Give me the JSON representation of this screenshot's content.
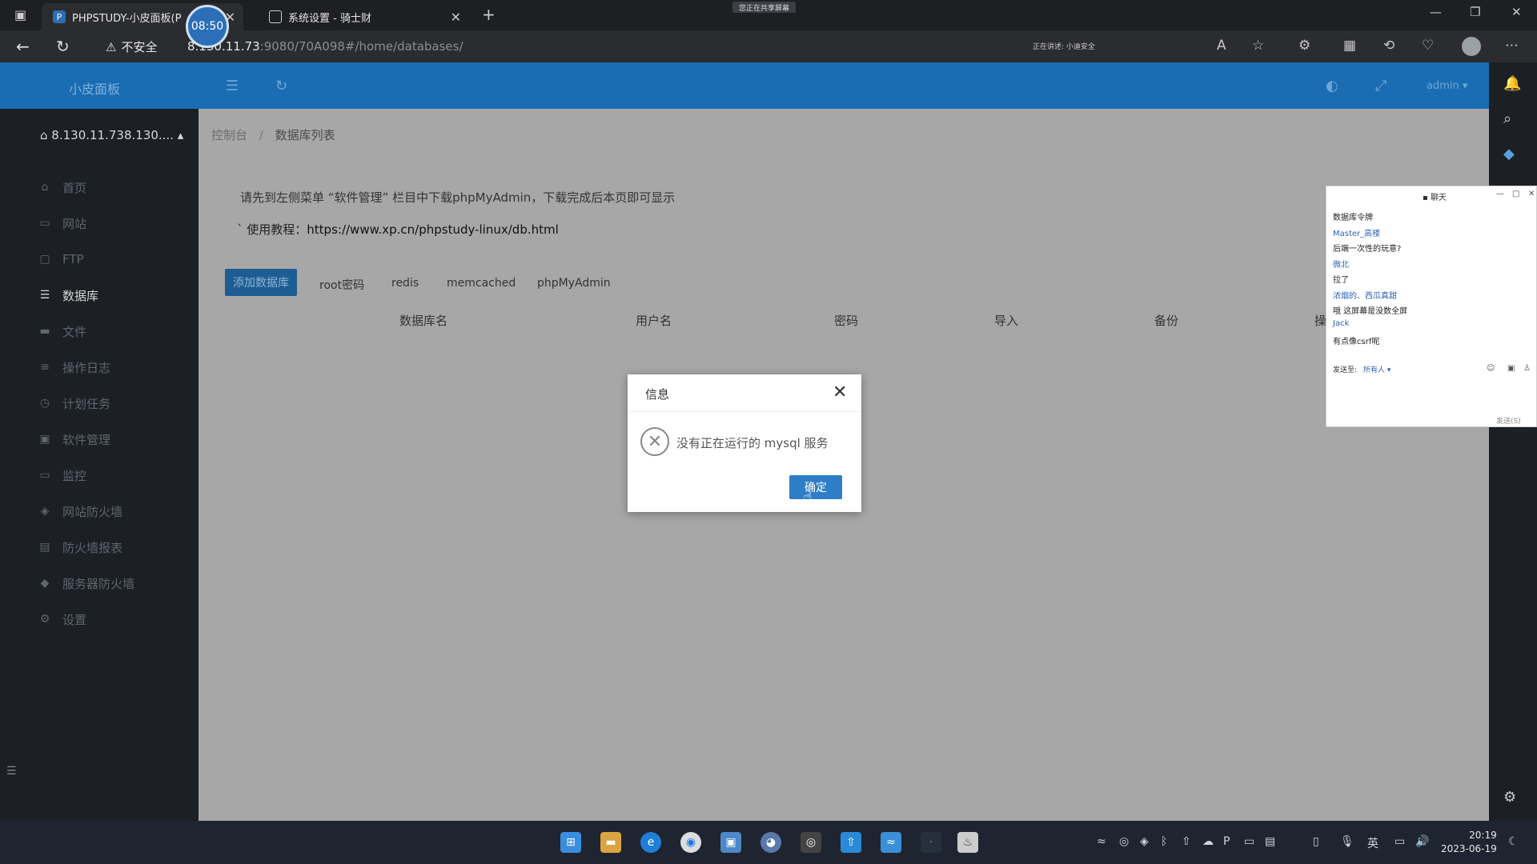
{
  "browser": {
    "tabs": [
      {
        "label": "PHPSTUDY-小皮面板(P",
        "active": true
      },
      {
        "label": "系统设置 - 骑士财",
        "active": false
      }
    ],
    "rec_timer": "08:50",
    "share_banner": "您正在共享屏幕",
    "insecure_label": "不安全",
    "url_host": "8.130.11.73",
    "url_rest": ":9080/70A098#/home/databases/",
    "mic_status": "正在讲述: 小迪安全"
  },
  "app": {
    "logo": "小皮面板",
    "user": "admin",
    "server": "8.130.11.738.130....",
    "nav": [
      {
        "icon": "home-icon",
        "label": "首页"
      },
      {
        "icon": "globe-icon",
        "label": "网站"
      },
      {
        "icon": "ftp-icon",
        "label": "FTP"
      },
      {
        "icon": "database-icon",
        "label": "数据库"
      },
      {
        "icon": "folder-icon",
        "label": "文件"
      },
      {
        "icon": "log-icon",
        "label": "操作日志"
      },
      {
        "icon": "clock-icon",
        "label": "计划任务"
      },
      {
        "icon": "package-icon",
        "label": "软件管理"
      },
      {
        "icon": "monitor-icon",
        "label": "监控"
      },
      {
        "icon": "shield-icon",
        "label": "网站防火墙"
      },
      {
        "icon": "report-icon",
        "label": "防火墙报表"
      },
      {
        "icon": "server-shield-icon",
        "label": "服务器防火墙"
      },
      {
        "icon": "gear-icon",
        "label": "设置"
      }
    ],
    "active_nav": "数据库",
    "breadcrumb": {
      "home": "控制台",
      "sep": "/",
      "current": "数据库列表"
    },
    "notice": "请先到左侧菜单 “软件管理” 栏目中下载phpMyAdmin，下载完成后本页即可显示",
    "tutorial_label": "` 使用教程：",
    "tutorial_link": "https://www.xp.cn/phpstudy-linux/db.html",
    "add_db_button": "添加数据库",
    "options": [
      "root密码",
      "redis",
      "memcached",
      "phpMyAdmin"
    ],
    "columns": [
      "数据库名",
      "用户名",
      "密码",
      "导入",
      "备份",
      "操"
    ]
  },
  "dialog": {
    "title": "信息",
    "message": "没有正在运行的 mysql 服务",
    "ok": "确定"
  },
  "chat": {
    "title": "聊天",
    "messages": [
      {
        "text": "数据库令牌",
        "name": false
      },
      {
        "text": "Master_高楼",
        "name": true
      },
      {
        "text": "后端一次性的玩意?",
        "name": false
      },
      {
        "text": "微北",
        "name": true
      },
      {
        "text": "拉了",
        "name": false
      },
      {
        "text": "浓烟的、西瓜真甜",
        "name": true
      },
      {
        "text": "哦 这屏幕是没数全屏",
        "name": false
      },
      {
        "text": "Jack",
        "name": true
      },
      {
        "text": "有点像csrf呢",
        "name": false
      }
    ],
    "send_to_label": "发送至:",
    "send_to_value": "所有人 ▾",
    "send_button": "发送(S)"
  },
  "taskbar": {
    "time": "20:19",
    "date": "2023-06-19",
    "ime": "英"
  }
}
